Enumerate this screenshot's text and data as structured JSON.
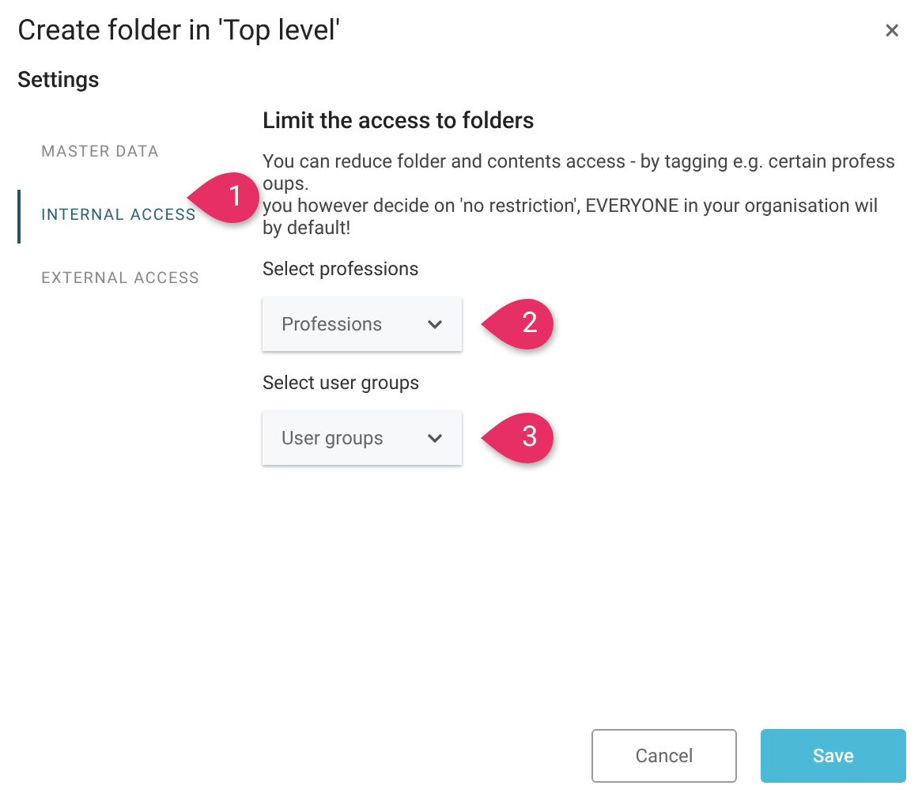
{
  "dialog": {
    "title": "Create folder in 'Top level'",
    "close": "×",
    "subtitle": "Settings"
  },
  "sidebar": {
    "items": [
      {
        "label": "MASTER DATA",
        "selected": false
      },
      {
        "label": "INTERNAL ACCESS",
        "selected": true
      },
      {
        "label": "EXTERNAL ACCESS",
        "selected": false
      }
    ]
  },
  "content": {
    "heading": "Limit the access to folders",
    "description": [
      "You can reduce folder and contents access - by tagging e.g. certain profess",
      "oups.",
      "you however decide on 'no restriction', EVERYONE in your organisation wil",
      "by default!"
    ],
    "fields": [
      {
        "label": "Select professions",
        "placeholder": "Professions",
        "callout": "2"
      },
      {
        "label": "Select user groups",
        "placeholder": "User groups",
        "callout": "3"
      }
    ]
  },
  "sidebar_callout": "1",
  "buttons": [
    {
      "label": "Cancel",
      "kind": "secondary"
    },
    {
      "label": "Save",
      "kind": "primary"
    }
  ]
}
